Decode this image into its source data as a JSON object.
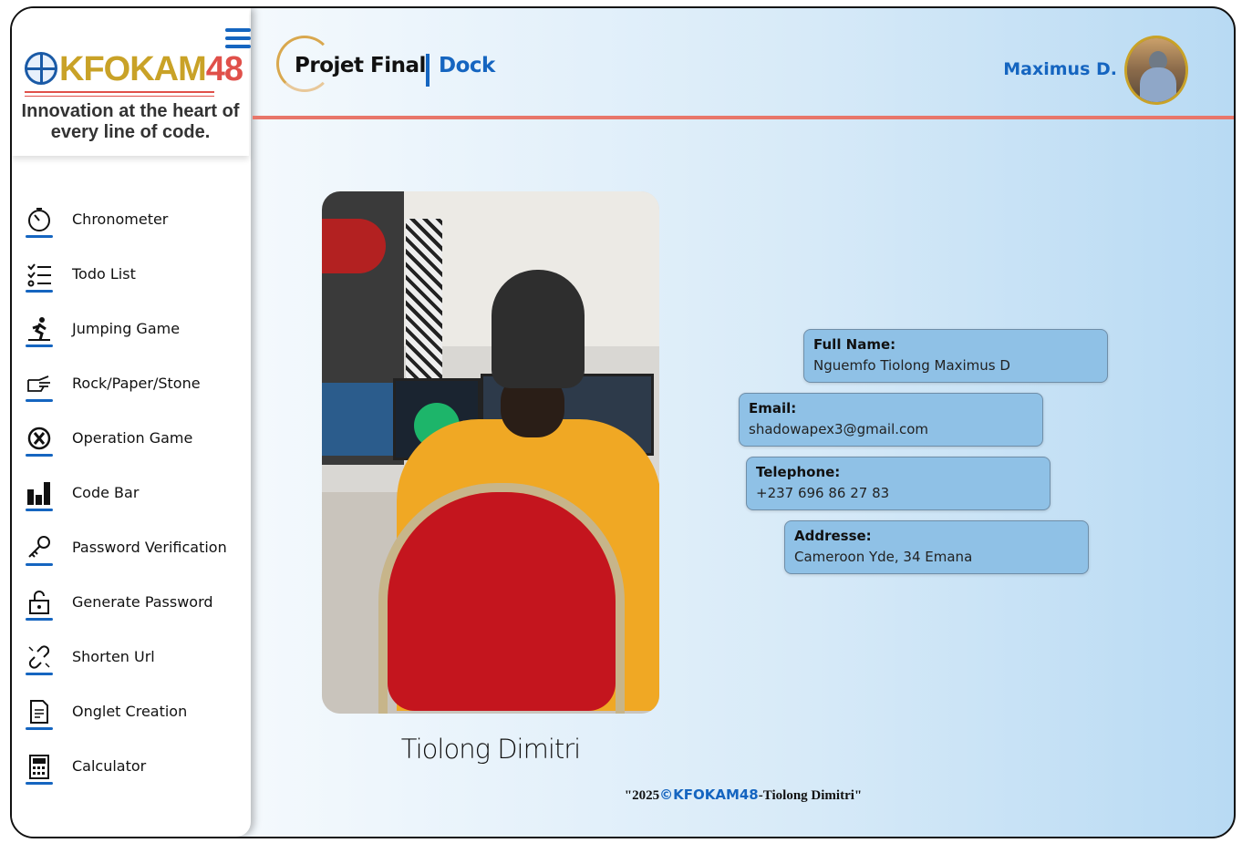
{
  "brand": {
    "logo_main": "KFOKAM",
    "logo_num": "48",
    "tagline": "Innovation at the heart of every line of code."
  },
  "sidebar": {
    "items": [
      {
        "label": "Chronometer",
        "icon": "stopwatch-icon"
      },
      {
        "label": "Todo List",
        "icon": "checklist-icon"
      },
      {
        "label": "Jumping Game",
        "icon": "runner-icon"
      },
      {
        "label": "Rock/Paper/Stone",
        "icon": "hand-icon"
      },
      {
        "label": "Operation Game",
        "icon": "x-circle-icon"
      },
      {
        "label": "Code Bar",
        "icon": "bar-chart-icon"
      },
      {
        "label": "Password Verification",
        "icon": "key-icon"
      },
      {
        "label": "Generate Password",
        "icon": "lock-icon"
      },
      {
        "label": "Shorten Url",
        "icon": "broken-link-icon"
      },
      {
        "label": "Onglet Creation",
        "icon": "document-icon"
      },
      {
        "label": "Calculator",
        "icon": "calculator-icon"
      }
    ]
  },
  "header": {
    "title": "Projet Final",
    "subtitle": "Dock",
    "user_name": "Maximus D."
  },
  "profile": {
    "caption": "Tiolong Dimitri",
    "cards": [
      {
        "label": "Full Name:",
        "value": "Nguemfo Tiolong Maximus D"
      },
      {
        "label": "Email:",
        "value": "shadowapex3@gmail.com"
      },
      {
        "label": "Telephone:",
        "value": "+237 696 86 27 83"
      },
      {
        "label": "Addresse:",
        "value": "Cameroon Yde, 34 Emana"
      }
    ]
  },
  "footer": {
    "prefix": "\"2025",
    "brand": "©KFOKAM48",
    "suffix": "-Tiolong Dimitri\""
  },
  "colors": {
    "accent": "#1565c0",
    "header_line": "#e8766a",
    "card_bg": "#8fc1e6"
  }
}
